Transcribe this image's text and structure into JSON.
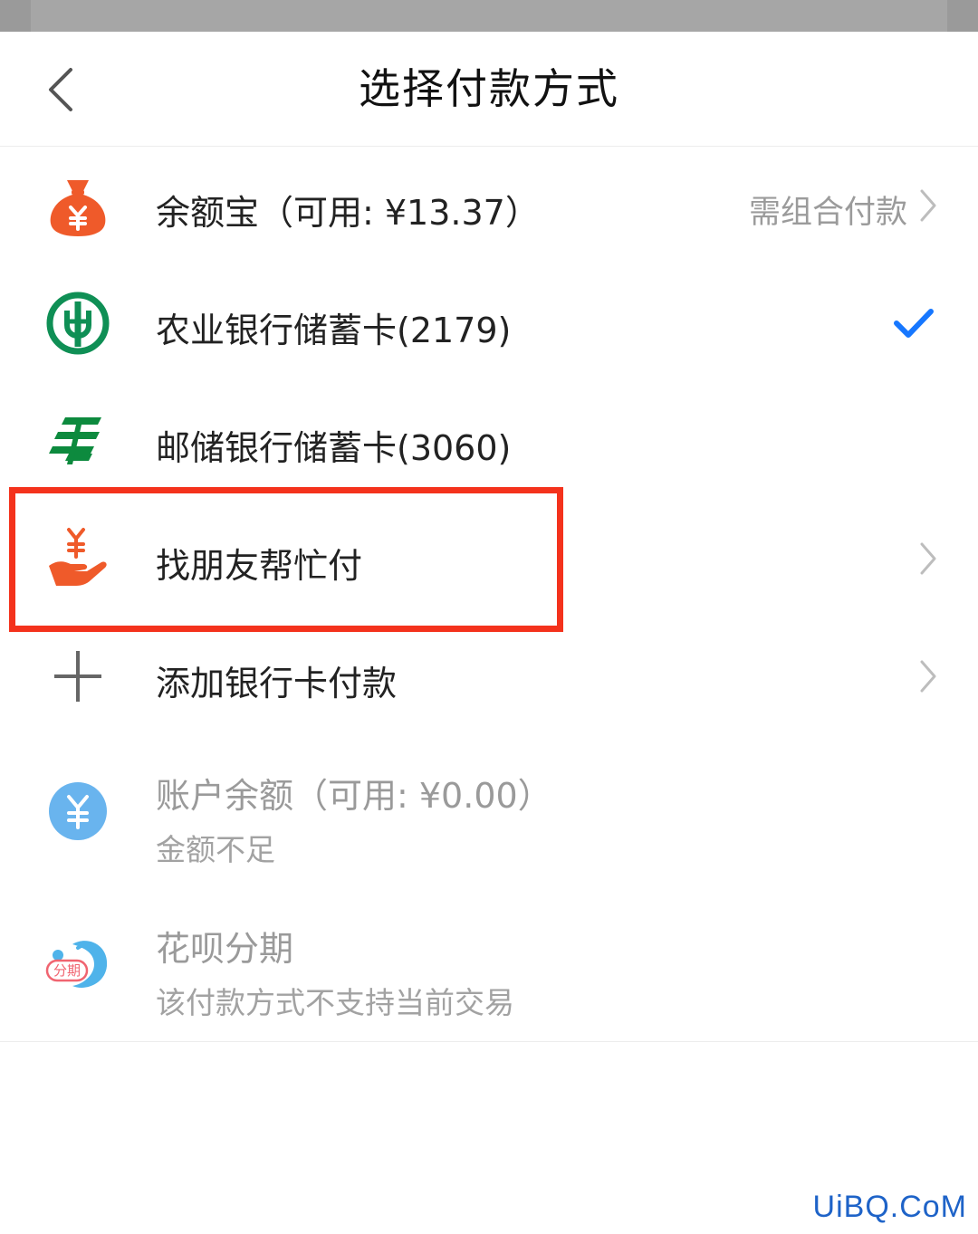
{
  "header": {
    "title": "选择付款方式"
  },
  "payment_methods": [
    {
      "label": "余额宝（可用: ¥13.37）",
      "hint": "需组合付款",
      "icon": "coin-bag-icon",
      "color": "#ef5a2a"
    },
    {
      "label": "农业银行储蓄卡(2179)",
      "icon": "abc-bank-logo-icon",
      "color": "#0f8f55",
      "selected": true
    },
    {
      "label": "邮储银行储蓄卡(3060)",
      "icon": "psbc-bank-logo-icon",
      "color": "#0d8a3e"
    },
    {
      "label": "找朋友帮忙付",
      "icon": "hand-coin-icon",
      "color": "#ef5a2a"
    },
    {
      "label": "添加银行卡付款",
      "icon": "plus-icon",
      "color": "#666666"
    },
    {
      "label": "账户余额（可用: ¥0.00）",
      "sub": "金额不足",
      "icon": "yuan-circle-icon",
      "color": "#69b4ee"
    },
    {
      "label": "花呗分期",
      "sub": "该付款方式不支持当前交易",
      "icon": "huabei-installment-icon",
      "icon_text": "分期",
      "color": "#4fb3ea"
    }
  ],
  "colors": {
    "accent_check": "#1677ff",
    "highlight_border": "#f4321c"
  },
  "watermark": "UiBQ.CoM"
}
